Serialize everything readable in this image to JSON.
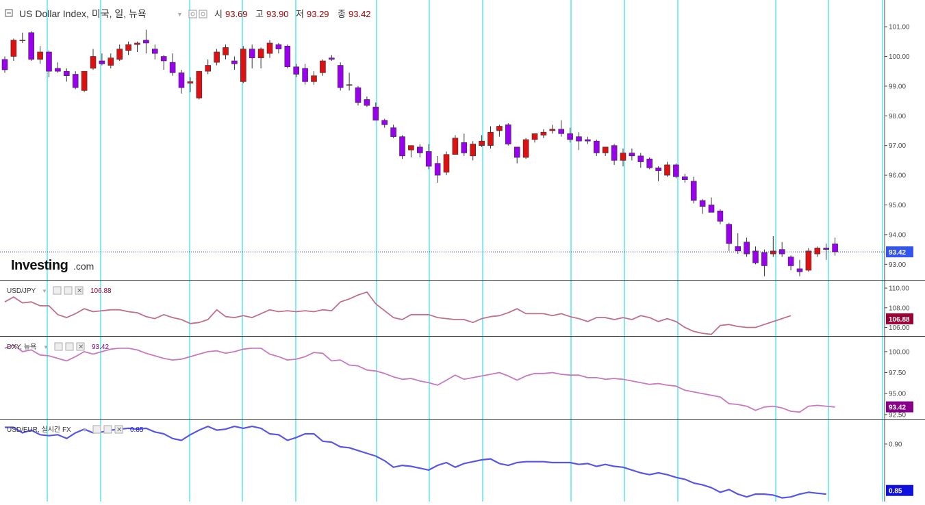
{
  "colors": {
    "up": "#dd1111",
    "down": "#9900ee",
    "vline": "#00d8e8",
    "hline": "#2222aa",
    "jpy_line": "#c06e8e",
    "dxy_line": "#c878c0",
    "eur_line": "#5555ee",
    "tag_main": "#3355ee",
    "tag_jpy": "#990033",
    "tag_dxy": "#880088",
    "tag_eur": "#1111dd"
  },
  "icons": [
    "collapse-icon",
    "settings-icon",
    "eye-icon",
    "close-icon"
  ],
  "main_legend": {
    "title": "US Dollar Index, 미국, 일, 뉴욕",
    "o_label": "시",
    "o_val": "93.69",
    "h_label": "고",
    "h_val": "93.90",
    "l_label": "저",
    "l_val": "93.29",
    "c_label": "종",
    "c_val": "93.42"
  },
  "branding": {
    "logo_main": "Investing",
    "logo_suffix": ".com"
  },
  "chart_data": [
    {
      "type": "candlestick",
      "title": "US Dollar Index, 미국, 일, 뉴욕",
      "ylim": [
        92.5,
        101.9
      ],
      "yticks": [
        "101.00",
        "100.00",
        "99.00",
        "98.00",
        "97.00",
        "96.00",
        "95.00",
        "94.00",
        "93.00"
      ],
      "last_value": "93.42",
      "grid": false,
      "ohlc": [
        [
          99.9,
          100.0,
          99.45,
          99.55
        ],
        [
          100.0,
          100.6,
          99.85,
          100.55
        ],
        [
          100.55,
          100.8,
          100.45,
          100.55
        ],
        [
          100.8,
          100.85,
          99.85,
          99.9
        ],
        [
          99.9,
          100.35,
          99.75,
          100.15
        ],
        [
          100.15,
          100.2,
          99.3,
          99.5
        ],
        [
          99.6,
          99.8,
          99.45,
          99.5
        ],
        [
          99.5,
          99.6,
          99.15,
          99.35
        ],
        [
          99.4,
          99.5,
          98.9,
          98.95
        ],
        [
          98.85,
          99.45,
          98.8,
          99.5
        ],
        [
          99.6,
          100.25,
          99.55,
          100.0
        ],
        [
          99.85,
          100.1,
          99.7,
          99.75
        ],
        [
          99.7,
          100.1,
          99.6,
          99.95
        ],
        [
          99.9,
          100.4,
          99.85,
          100.25
        ],
        [
          100.2,
          100.5,
          100.05,
          100.4
        ],
        [
          100.4,
          100.5,
          100.15,
          100.45
        ],
        [
          100.55,
          100.9,
          100.1,
          100.45
        ],
        [
          100.25,
          100.4,
          99.9,
          100.1
        ],
        [
          100.0,
          100.05,
          99.55,
          99.85
        ],
        [
          99.8,
          100.1,
          99.35,
          99.45
        ],
        [
          99.45,
          99.55,
          98.75,
          98.95
        ],
        [
          99.1,
          99.3,
          98.8,
          99.15
        ],
        [
          98.6,
          99.5,
          98.55,
          99.5
        ],
        [
          99.5,
          99.9,
          99.4,
          99.7
        ],
        [
          99.8,
          100.25,
          99.7,
          100.15
        ],
        [
          100.05,
          100.4,
          99.9,
          100.3
        ],
        [
          99.85,
          100.0,
          99.55,
          99.75
        ],
        [
          99.15,
          100.35,
          99.1,
          100.25
        ],
        [
          100.25,
          100.4,
          99.6,
          99.95
        ],
        [
          99.95,
          100.3,
          99.6,
          100.25
        ],
        [
          100.1,
          100.55,
          99.95,
          100.45
        ],
        [
          100.4,
          100.45,
          100.1,
          100.25
        ],
        [
          100.35,
          100.4,
          99.6,
          99.65
        ],
        [
          99.65,
          99.75,
          99.3,
          99.4
        ],
        [
          99.6,
          99.75,
          99.05,
          99.15
        ],
        [
          99.15,
          99.5,
          99.05,
          99.35
        ],
        [
          99.45,
          99.9,
          99.35,
          99.85
        ],
        [
          99.95,
          100.05,
          99.85,
          99.9
        ],
        [
          99.7,
          99.8,
          98.85,
          98.95
        ],
        [
          99.05,
          99.45,
          98.85,
          99.05
        ],
        [
          98.95,
          99.0,
          98.35,
          98.45
        ],
        [
          98.55,
          98.65,
          98.3,
          98.35
        ],
        [
          98.3,
          98.45,
          97.85,
          97.85
        ],
        [
          97.85,
          97.9,
          97.6,
          97.7
        ],
        [
          97.6,
          97.7,
          97.25,
          97.3
        ],
        [
          97.3,
          97.35,
          96.55,
          96.65
        ],
        [
          96.85,
          96.95,
          96.6,
          97.0
        ],
        [
          96.95,
          97.05,
          96.6,
          96.75
        ],
        [
          96.8,
          97.05,
          96.2,
          96.3
        ],
        [
          96.4,
          96.65,
          95.75,
          96.0
        ],
        [
          96.1,
          96.8,
          96.0,
          96.7
        ],
        [
          96.7,
          97.35,
          96.75,
          97.25
        ],
        [
          97.1,
          97.4,
          96.65,
          96.75
        ],
        [
          96.65,
          97.15,
          96.5,
          97.05
        ],
        [
          97.0,
          97.35,
          96.95,
          97.15
        ],
        [
          97.0,
          97.65,
          96.9,
          97.45
        ],
        [
          97.5,
          97.7,
          97.3,
          97.65
        ],
        [
          97.7,
          97.75,
          97.0,
          97.05
        ],
        [
          96.95,
          96.95,
          96.4,
          96.6
        ],
        [
          96.6,
          97.25,
          96.55,
          97.2
        ],
        [
          97.2,
          97.4,
          97.1,
          97.4
        ],
        [
          97.35,
          97.55,
          97.25,
          97.45
        ],
        [
          97.5,
          97.7,
          97.4,
          97.55
        ],
        [
          97.55,
          97.85,
          97.3,
          97.4
        ],
        [
          97.4,
          97.6,
          97.1,
          97.2
        ],
        [
          97.3,
          97.45,
          96.85,
          97.15
        ],
        [
          97.2,
          97.3,
          97.05,
          97.15
        ],
        [
          97.15,
          97.2,
          96.65,
          96.75
        ],
        [
          96.75,
          96.95,
          96.65,
          96.95
        ],
        [
          97.0,
          97.05,
          96.35,
          96.5
        ],
        [
          96.5,
          96.9,
          96.3,
          96.75
        ],
        [
          96.75,
          96.9,
          96.5,
          96.65
        ],
        [
          96.65,
          96.75,
          96.25,
          96.45
        ],
        [
          96.55,
          96.6,
          96.2,
          96.25
        ],
        [
          96.25,
          96.3,
          95.8,
          96.15
        ],
        [
          96.0,
          96.45,
          95.95,
          96.35
        ],
        [
          96.35,
          96.4,
          95.9,
          95.95
        ],
        [
          95.95,
          96.05,
          95.75,
          95.85
        ],
        [
          95.8,
          95.95,
          95.05,
          95.15
        ],
        [
          95.15,
          95.2,
          94.7,
          94.95
        ],
        [
          95.0,
          95.25,
          94.85,
          94.75
        ],
        [
          94.8,
          94.85,
          94.35,
          94.45
        ],
        [
          94.35,
          94.4,
          93.45,
          93.7
        ],
        [
          93.6,
          94.05,
          93.35,
          93.45
        ],
        [
          93.75,
          93.9,
          93.25,
          93.35
        ],
        [
          93.45,
          93.6,
          93.0,
          93.05
        ],
        [
          93.4,
          93.5,
          92.6,
          92.95
        ],
        [
          93.35,
          93.95,
          93.25,
          93.45
        ],
        [
          93.5,
          93.75,
          93.25,
          93.35
        ],
        [
          93.25,
          93.3,
          92.8,
          92.95
        ],
        [
          92.85,
          93.15,
          92.6,
          92.75
        ],
        [
          92.8,
          93.55,
          92.75,
          93.45
        ],
        [
          93.35,
          93.6,
          93.25,
          93.55
        ],
        [
          93.55,
          93.7,
          93.15,
          93.5
        ],
        [
          93.69,
          93.9,
          93.29,
          93.42
        ]
      ]
    },
    {
      "type": "line",
      "title": "USD/JPY",
      "last_value": "106.88",
      "ylim": [
        105.2,
        110.7
      ],
      "yticks": [
        "110.00",
        "108.00",
        "106.00"
      ],
      "series": [
        {
          "name": "USD/JPY",
          "values": [
            108.6,
            109.1,
            108.5,
            108.6,
            108.2,
            108.2,
            107.3,
            107.0,
            107.4,
            107.9,
            107.6,
            107.7,
            107.8,
            107.8,
            107.6,
            107.5,
            107.1,
            106.9,
            107.3,
            107.0,
            106.8,
            106.4,
            106.5,
            106.8,
            107.8,
            107.1,
            107.0,
            107.2,
            107.0,
            107.4,
            107.8,
            107.6,
            107.7,
            107.6,
            107.7,
            107.6,
            107.8,
            107.7,
            108.6,
            108.9,
            109.3,
            109.6,
            108.4,
            107.7,
            107.0,
            106.8,
            107.3,
            107.3,
            107.3,
            107.0,
            106.9,
            106.8,
            106.8,
            106.5,
            106.9,
            107.1,
            107.2,
            107.5,
            107.9,
            107.4,
            107.4,
            107.4,
            107.2,
            107.4,
            107.1,
            106.9,
            106.6,
            107.0,
            107.0,
            106.8,
            107.0,
            106.8,
            107.2,
            107.0,
            106.6,
            106.9,
            106.6,
            106.0,
            105.6,
            105.4,
            105.3,
            106.2,
            106.3,
            106.1,
            106.0,
            106.0,
            106.3,
            106.6,
            106.9,
            107.2
          ]
        }
      ]
    },
    {
      "type": "line",
      "title": "DXY, 뉴욕",
      "last_value": "93.42",
      "ylim": [
        92.0,
        101.7
      ],
      "yticks": [
        "100.00",
        "97.50",
        "95.00",
        "92.50"
      ],
      "series": [
        {
          "name": "DXY, 뉴욕",
          "values": [
            100.4,
            100.8,
            100.0,
            100.2,
            99.6,
            99.5,
            99.2,
            98.9,
            99.4,
            100.0,
            99.7,
            100.0,
            100.3,
            100.4,
            100.4,
            100.2,
            99.8,
            99.5,
            99.2,
            99.0,
            99.1,
            99.4,
            99.7,
            100.0,
            100.1,
            99.8,
            100.0,
            100.3,
            100.4,
            100.4,
            99.7,
            99.4,
            99.0,
            99.1,
            99.4,
            99.9,
            99.8,
            98.9,
            99.0,
            98.4,
            98.3,
            97.8,
            97.7,
            97.4,
            97.0,
            96.7,
            96.8,
            96.5,
            96.3,
            96.0,
            96.6,
            97.2,
            96.7,
            96.9,
            97.1,
            97.3,
            97.5,
            97.1,
            96.6,
            97.1,
            97.4,
            97.4,
            97.5,
            97.3,
            97.2,
            97.2,
            96.9,
            96.9,
            96.7,
            96.8,
            96.7,
            96.5,
            96.3,
            96.1,
            96.2,
            96.0,
            95.9,
            95.4,
            95.2,
            95.0,
            94.8,
            94.6,
            93.8,
            93.7,
            93.5,
            93.0,
            93.4,
            93.5,
            93.3,
            92.9,
            92.8,
            93.5,
            93.6,
            93.5,
            93.4
          ]
        }
      ]
    },
    {
      "type": "line",
      "title": "USD/EUR, 실시간 FX",
      "last_value": "0.85",
      "ylim": [
        0.838,
        0.925
      ],
      "yticks": [
        "0.90"
      ],
      "series": [
        {
          "name": "USD/EUR, 실시간 FX",
          "values": [
            0.918,
            0.918,
            0.912,
            0.915,
            0.91,
            0.909,
            0.91,
            0.906,
            0.912,
            0.916,
            0.912,
            0.913,
            0.915,
            0.916,
            0.917,
            0.916,
            0.917,
            0.913,
            0.911,
            0.906,
            0.904,
            0.91,
            0.915,
            0.919,
            0.915,
            0.916,
            0.919,
            0.917,
            0.919,
            0.917,
            0.911,
            0.91,
            0.904,
            0.907,
            0.911,
            0.911,
            0.903,
            0.902,
            0.897,
            0.896,
            0.893,
            0.89,
            0.887,
            0.882,
            0.875,
            0.877,
            0.876,
            0.874,
            0.872,
            0.877,
            0.88,
            0.875,
            0.879,
            0.881,
            0.883,
            0.884,
            0.879,
            0.877,
            0.88,
            0.881,
            0.881,
            0.881,
            0.88,
            0.88,
            0.88,
            0.878,
            0.879,
            0.876,
            0.878,
            0.876,
            0.875,
            0.872,
            0.869,
            0.867,
            0.869,
            0.867,
            0.864,
            0.862,
            0.858,
            0.856,
            0.853,
            0.848,
            0.851,
            0.846,
            0.843,
            0.846,
            0.846,
            0.845,
            0.842,
            0.843,
            0.846,
            0.848,
            0.847,
            0.846
          ]
        }
      ]
    }
  ]
}
